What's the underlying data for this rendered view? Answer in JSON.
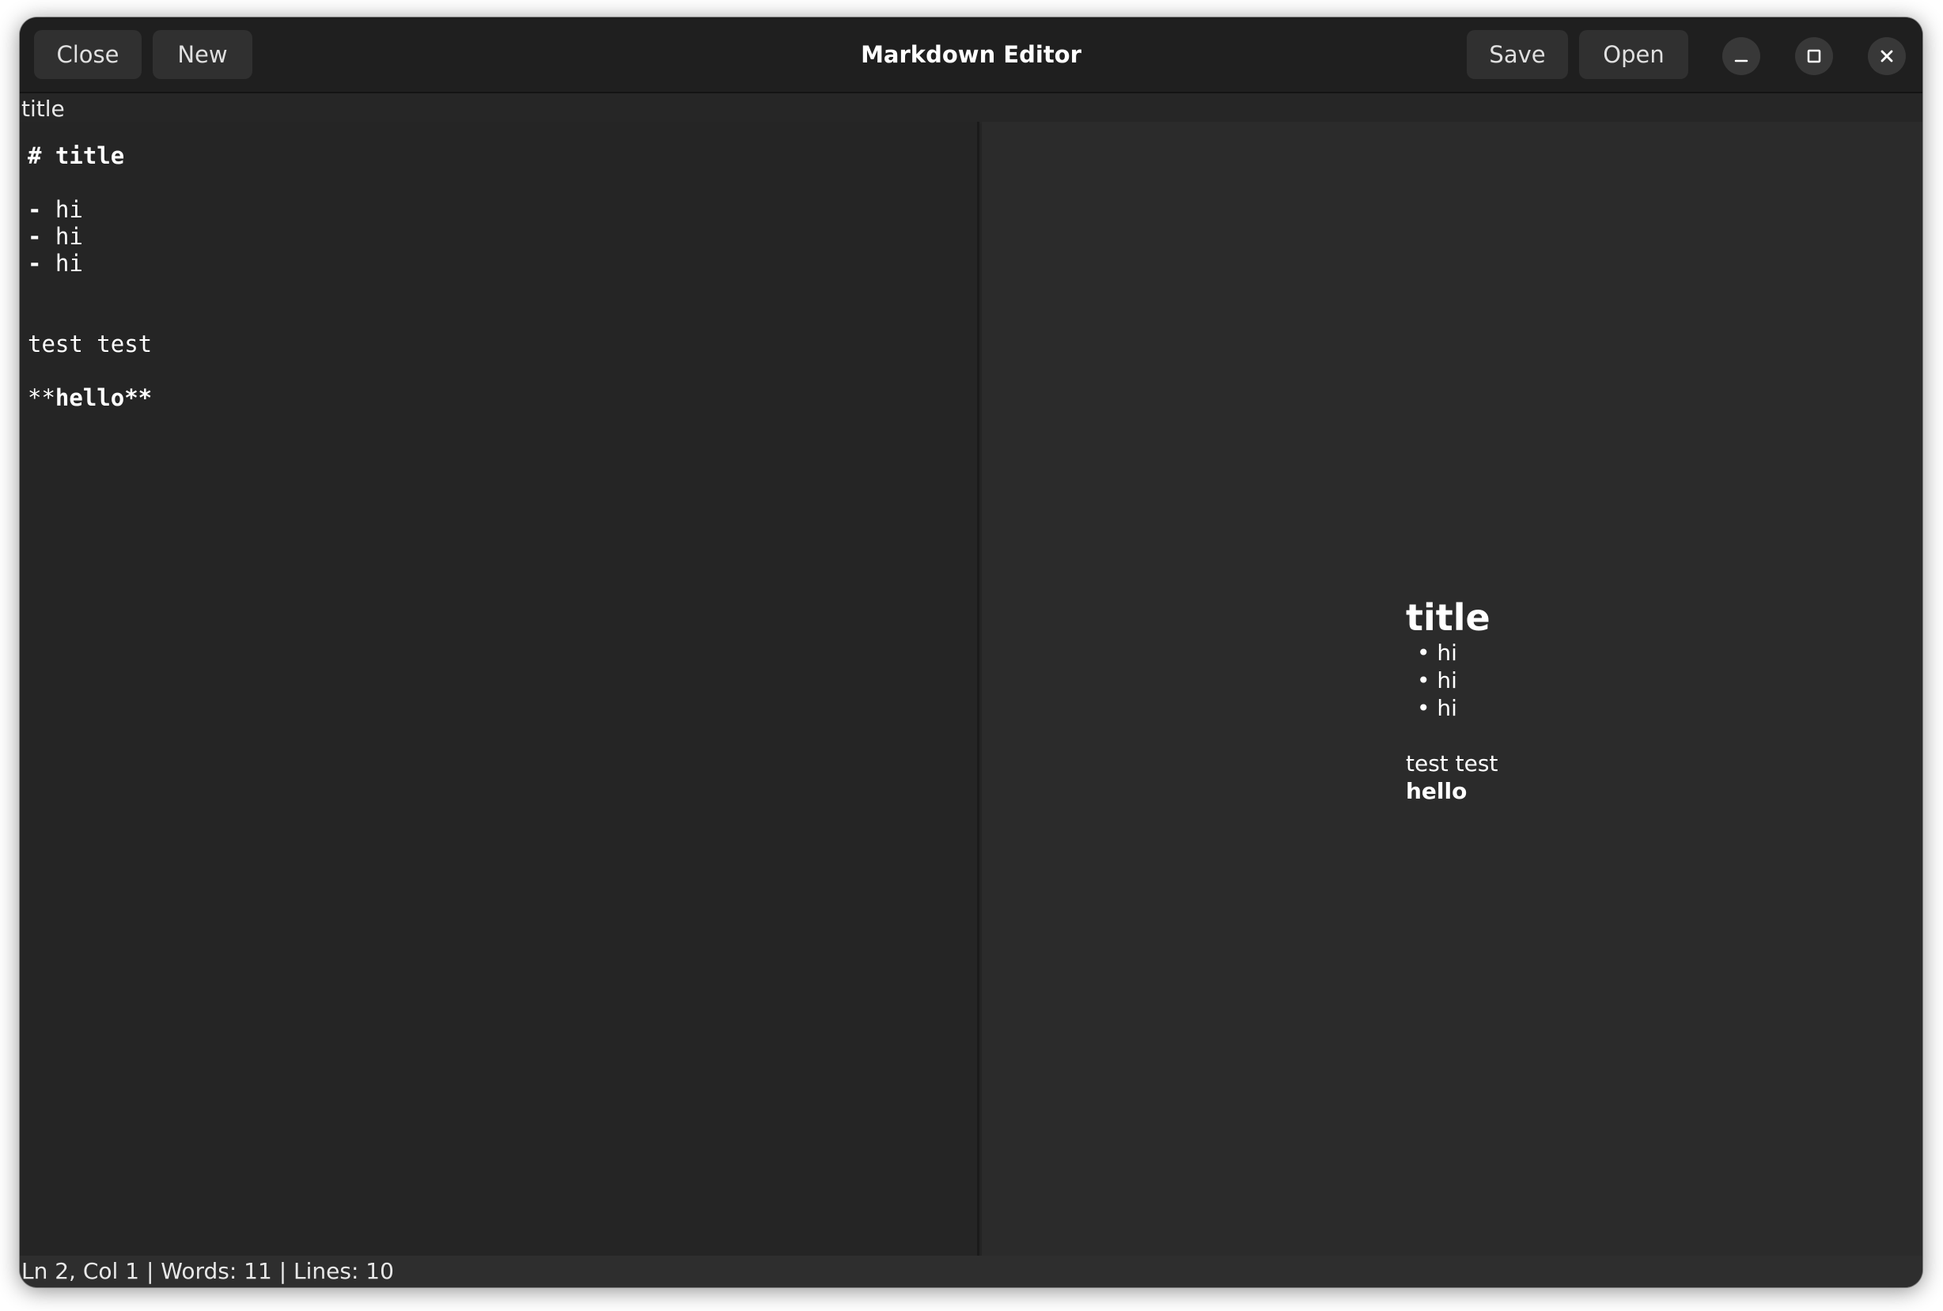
{
  "window": {
    "title": "Markdown Editor"
  },
  "header": {
    "close_label": "Close",
    "new_label": "New",
    "save_label": "Save",
    "open_label": "Open"
  },
  "document": {
    "filename": "title"
  },
  "editor": {
    "lines": [
      {
        "prefix": "# ",
        "text": "title",
        "bold": true
      },
      {
        "prefix": "",
        "text": ""
      },
      {
        "prefix": "- ",
        "text": "hi"
      },
      {
        "prefix": "- ",
        "text": "hi"
      },
      {
        "prefix": "- ",
        "text": "hi"
      },
      {
        "prefix": "",
        "text": ""
      },
      {
        "prefix": "",
        "text": ""
      },
      {
        "prefix": "",
        "text": "test test"
      },
      {
        "prefix": "",
        "text": ""
      },
      {
        "prefix": "**",
        "text": "hello**",
        "bold": true
      }
    ]
  },
  "preview": {
    "heading": "title",
    "list": [
      "hi",
      "hi",
      "hi"
    ],
    "paragraph": "test test",
    "bold_text": "hello"
  },
  "status": {
    "text": "Ln 2, Col 1 | Words: 11 | Lines: 10"
  },
  "icons": {
    "minimize": "minimize-icon",
    "maximize": "maximize-icon",
    "close": "close-icon"
  },
  "colors": {
    "window_bg": "#242424",
    "headerbar_bg": "#1f1f1f",
    "editor_bg": "#252525",
    "preview_bg": "#2b2b2b",
    "button_bg": "#303030",
    "text": "#ffffff"
  }
}
